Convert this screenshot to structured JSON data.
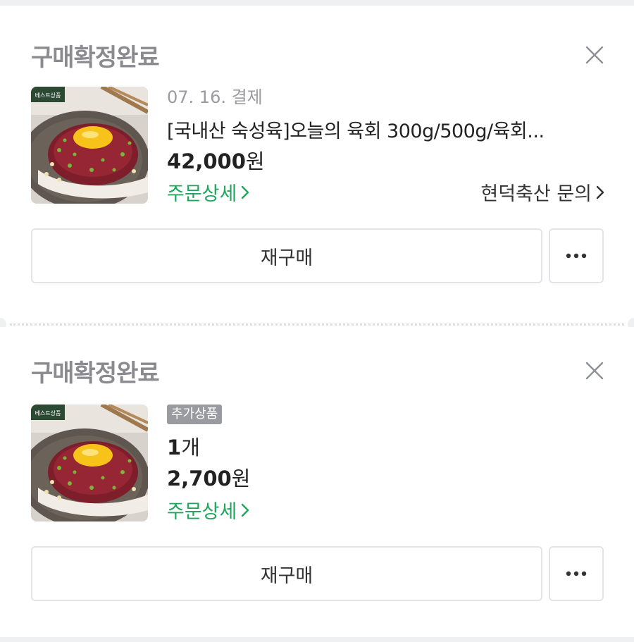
{
  "orders": [
    {
      "status": "구매확정완료",
      "date": "07. 16. 결제",
      "product_name": "[국내산 숙성육]오늘의 육회 300g/500g/육회...",
      "price_number": "42,000",
      "price_unit": "원",
      "detail_link": "주문상세",
      "seller_link": "현덕축산 문의",
      "rebuy_label": "재구매",
      "thumb_badge": "베스트상품"
    },
    {
      "status": "구매확정완료",
      "badge": "추가상품",
      "qty_number": "1",
      "qty_unit": "개",
      "price_number": "2,700",
      "price_unit": "원",
      "detail_link": "주문상세",
      "rebuy_label": "재구매",
      "thumb_badge": "베스트상품"
    }
  ],
  "icons": {
    "close": "close-icon",
    "more": "more-dots-icon",
    "chevron": "chevron-right-icon"
  },
  "colors": {
    "accent_green": "#1ea75b",
    "status_gray": "#8a8a8f",
    "badge_gray": "#9a9ba0"
  }
}
